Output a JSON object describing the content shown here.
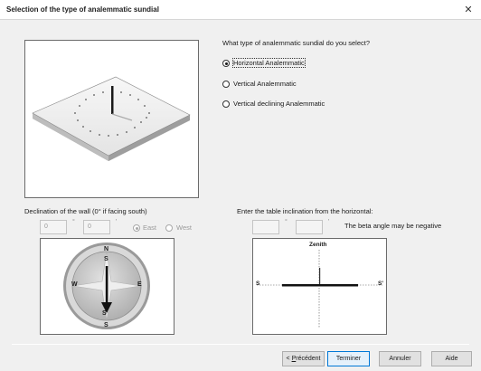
{
  "window": {
    "title": "Selection of the type of analemmatic sundial",
    "close_icon": "close-icon"
  },
  "question": {
    "text": "What type of analemmatic sundial do you select?",
    "options": [
      {
        "label": "Horizontal Analemmatic",
        "selected": true
      },
      {
        "label": "Vertical Analemmatic",
        "selected": false
      },
      {
        "label": "Vertical declining Analemmatic",
        "selected": false
      }
    ]
  },
  "declination": {
    "label": "Declination of the wall (0° if facing south)",
    "value1": "0",
    "value2": "0",
    "degree_symbol": "°",
    "minute_symbol": "'",
    "east_label": "East",
    "west_label": "West",
    "east_selected": true,
    "compass": {
      "n": "N",
      "s_top": "S",
      "w": "W",
      "e": "E",
      "s_arrow": "S'",
      "s_bottom": "S"
    }
  },
  "inclination": {
    "label": "Enter the table inclination from the horizontal:",
    "value1": "",
    "value2": "",
    "degree_symbol": "°",
    "minute_symbol": "'",
    "beta_note": "The beta angle may be negative",
    "diagram": {
      "zenith": "Zenith",
      "s_left": "S",
      "s_right": "S'"
    }
  },
  "buttons": {
    "previous_prefix": "< ",
    "previous_key": "P",
    "previous_rest": "récédent",
    "finish": "Terminer",
    "cancel": "Annuler",
    "help": "Aide"
  },
  "colors": {
    "focus_border": "#0078d7",
    "compass_face": "#c8c8c8"
  }
}
